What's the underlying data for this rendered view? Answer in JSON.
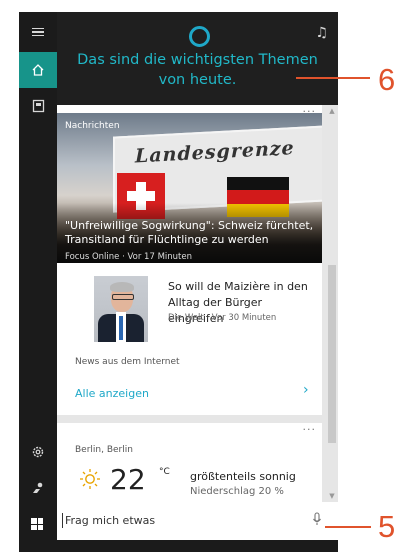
{
  "cortana": {
    "headline_line1": "Das sind die wichtigsten Themen",
    "headline_line2": "von heute."
  },
  "news_card": {
    "section_label": "Nachrichten",
    "image_sign_text": "Landesgrenze",
    "top_story_title": "\"Unfreiwillige Sogwirkung\": Schweiz fürchtet, Transitland für Flüchtlinge zu werden",
    "top_story_source": "Focus Online · Vor 17 Minuten",
    "story2_title": "So will de Maizière in den Alltag der Bürger eingreifen",
    "story2_source": "Die Welt · Vor 30 Minuten",
    "news_internet_label": "News aus dem Internet",
    "show_all_label": "Alle anzeigen",
    "chevron": "›"
  },
  "weather_card": {
    "location": "Berlin, Berlin",
    "temperature": "22",
    "unit": "°C",
    "condition": "größtenteils sonnig",
    "precipitation": "Niederschlag 20 %"
  },
  "search": {
    "placeholder": "Frag mich etwas"
  },
  "callouts": {
    "top": "6",
    "bottom": "5"
  },
  "colors": {
    "accent_teal": "#17948a",
    "cortana_blue": "#1fa8c8",
    "callout_orange": "#e0532c",
    "panel_dark": "#1f1f1f"
  },
  "icons": {
    "menu": "hamburger-icon",
    "home": "home-icon",
    "notebook": "notebook-icon",
    "settings": "gear-icon",
    "feedback": "feedback-icon",
    "windows": "windows-icon",
    "mic": "microphone-icon"
  }
}
